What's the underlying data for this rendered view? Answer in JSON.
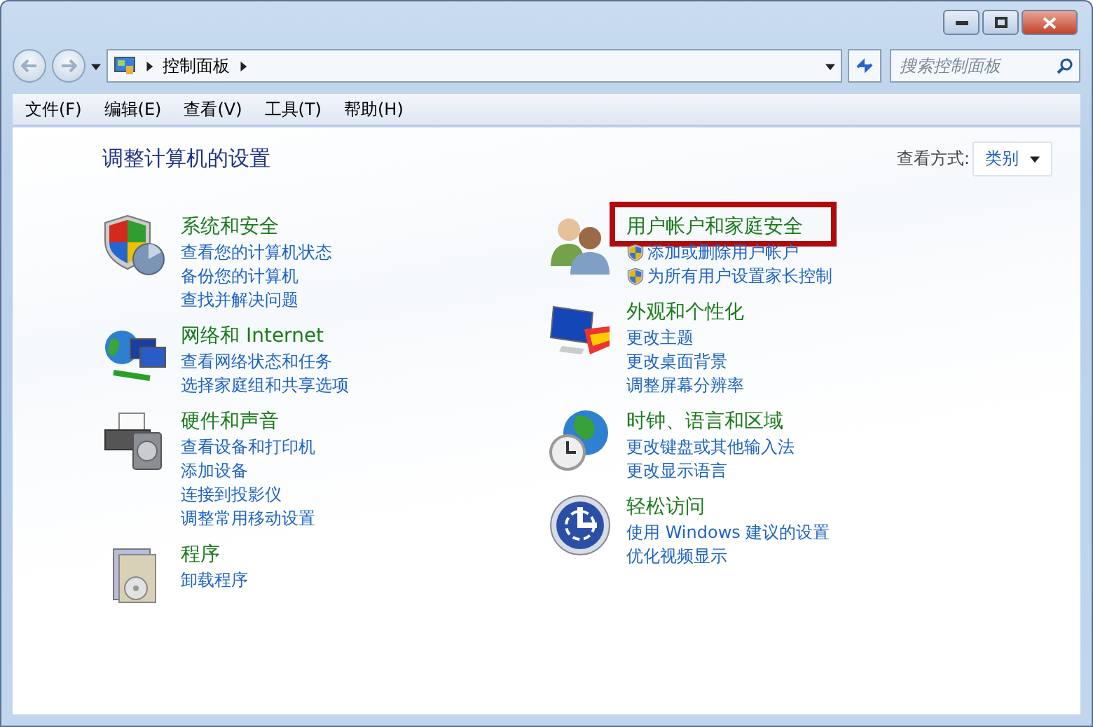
{
  "address_bar": {
    "breadcrumb": [
      "控制面板"
    ]
  },
  "search": {
    "placeholder": "搜索控制面板"
  },
  "menu": [
    "文件(F)",
    "编辑(E)",
    "查看(V)",
    "工具(T)",
    "帮助(H)"
  ],
  "heading": "调整计算机的设置",
  "view_by": {
    "label": "查看方式:",
    "value": "类别"
  },
  "columns": [
    {
      "categories": [
        {
          "kind": "shield",
          "title": "系统和安全",
          "highlighted": false,
          "links": [
            {
              "text": "查看您的计算机状态",
              "shield": false
            },
            {
              "text": "备份您的计算机",
              "shield": false
            },
            {
              "text": "查找并解决问题",
              "shield": false
            }
          ]
        },
        {
          "kind": "network",
          "title": "网络和 Internet",
          "highlighted": false,
          "links": [
            {
              "text": "查看网络状态和任务",
              "shield": false
            },
            {
              "text": "选择家庭组和共享选项",
              "shield": false
            }
          ]
        },
        {
          "kind": "printer",
          "title": "硬件和声音",
          "highlighted": false,
          "links": [
            {
              "text": "查看设备和打印机",
              "shield": false
            },
            {
              "text": "添加设备",
              "shield": false
            },
            {
              "text": "连接到投影仪",
              "shield": false
            },
            {
              "text": "调整常用移动设置",
              "shield": false
            }
          ]
        },
        {
          "kind": "box",
          "title": "程序",
          "highlighted": false,
          "links": [
            {
              "text": "卸载程序",
              "shield": false
            }
          ]
        }
      ]
    },
    {
      "categories": [
        {
          "kind": "users",
          "title": "用户帐户和家庭安全",
          "highlighted": true,
          "links": [
            {
              "text": "添加或删除用户帐户",
              "shield": true
            },
            {
              "text": "为所有用户设置家长控制",
              "shield": true
            }
          ]
        },
        {
          "kind": "monitor",
          "title": "外观和个性化",
          "highlighted": false,
          "links": [
            {
              "text": "更改主题",
              "shield": false
            },
            {
              "text": "更改桌面背景",
              "shield": false
            },
            {
              "text": "调整屏幕分辨率",
              "shield": false
            }
          ]
        },
        {
          "kind": "clock",
          "title": "时钟、语言和区域",
          "highlighted": false,
          "links": [
            {
              "text": "更改键盘或其他输入法",
              "shield": false
            },
            {
              "text": "更改显示语言",
              "shield": false
            }
          ]
        },
        {
          "kind": "access",
          "title": "轻松访问",
          "highlighted": false,
          "links": [
            {
              "text": "使用 Windows 建议的设置",
              "shield": false
            },
            {
              "text": "优化视频显示",
              "shield": false
            }
          ]
        }
      ]
    }
  ]
}
